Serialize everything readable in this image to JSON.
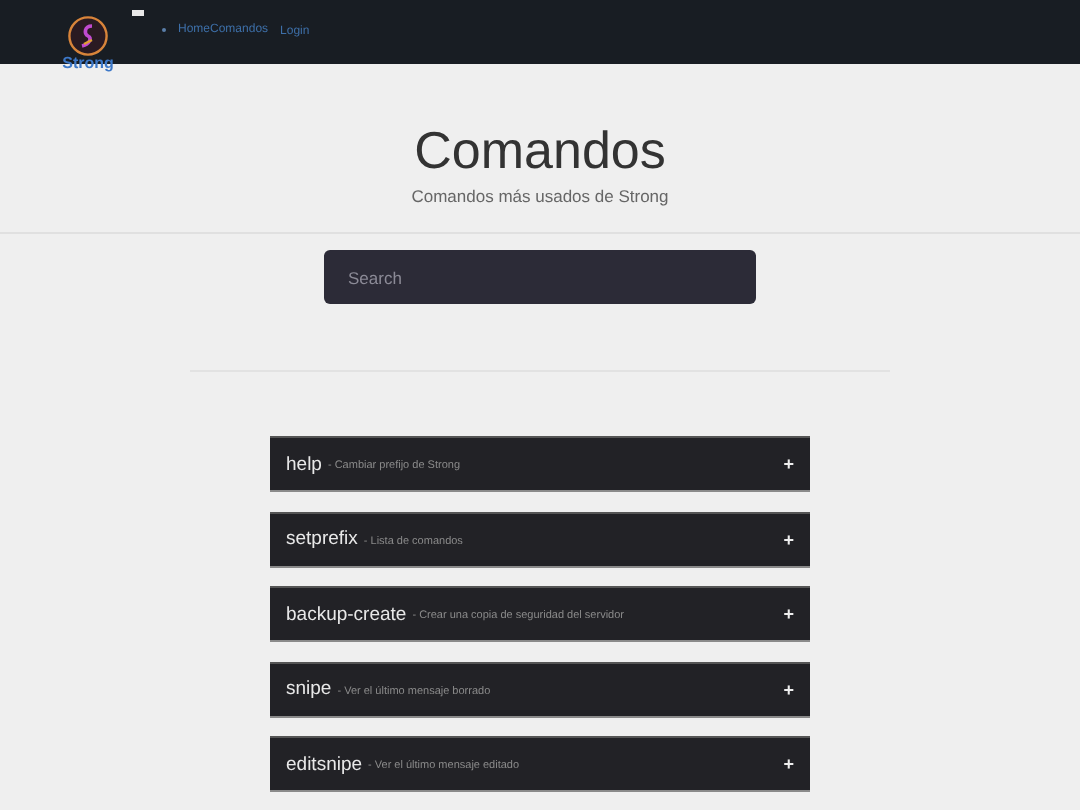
{
  "navbar": {
    "brand": "Strong",
    "links": [
      {
        "label": "Home"
      },
      {
        "label": "Comandos"
      }
    ],
    "login": "Login"
  },
  "header": {
    "title": "Comandos",
    "subtitle": "Comandos más usados de Strong"
  },
  "search": {
    "placeholder": "Search"
  },
  "commands": [
    {
      "name": "help",
      "description": "- Cambiar prefijo de Strong",
      "expand": "+"
    },
    {
      "name": "setprefix",
      "description": "- Lista de comandos",
      "expand": "+"
    },
    {
      "name": "backup-create",
      "description": "- Crear una copia de seguridad del servidor",
      "expand": "+"
    },
    {
      "name": "snipe",
      "description": "- Ver el último mensaje borrado",
      "expand": "+"
    },
    {
      "name": "editsnipe",
      "description": "- Ver el último mensaje editado",
      "expand": "+"
    }
  ]
}
